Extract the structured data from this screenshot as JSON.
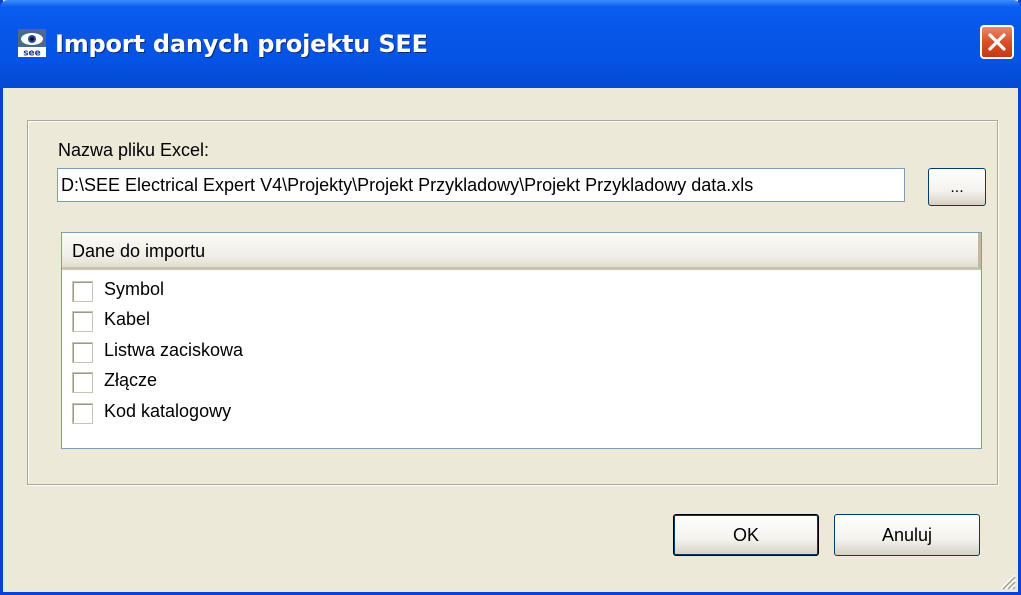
{
  "window": {
    "title": "Import danych projektu SEE",
    "icon": "see-logo-icon",
    "close_icon": "close-icon"
  },
  "file": {
    "label": "Nazwa pliku Excel:",
    "path": "D:\\SEE Electrical Expert V4\\Projekty\\Projekt Przykladowy\\Projekt Przykladowy data.xls",
    "browse_label": "..."
  },
  "import_list": {
    "header": "Dane do importu",
    "items": [
      {
        "label": "Symbol",
        "checked": false
      },
      {
        "label": "Kabel",
        "checked": false
      },
      {
        "label": "Listwa zaciskowa",
        "checked": false
      },
      {
        "label": "Złącze",
        "checked": false
      },
      {
        "label": "Kod katalogowy",
        "checked": false
      }
    ]
  },
  "buttons": {
    "ok_label": "OK",
    "cancel_label": "Anuluj"
  },
  "colors": {
    "titlebar": "#0553e4",
    "dialog_bg": "#ece9d8",
    "close_button": "#d8502a"
  }
}
